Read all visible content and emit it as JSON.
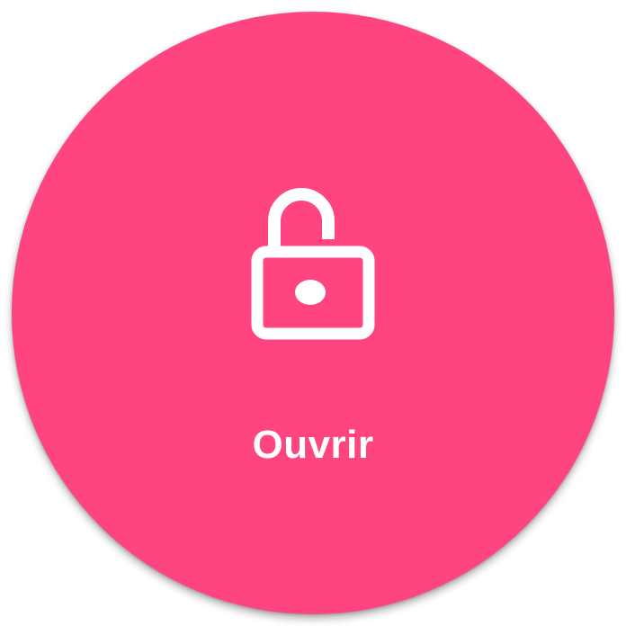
{
  "button": {
    "label": "Ouvrir",
    "icon": "unlocked-padlock-icon",
    "background_color": "#ff4580",
    "foreground_color": "#ffffff"
  }
}
